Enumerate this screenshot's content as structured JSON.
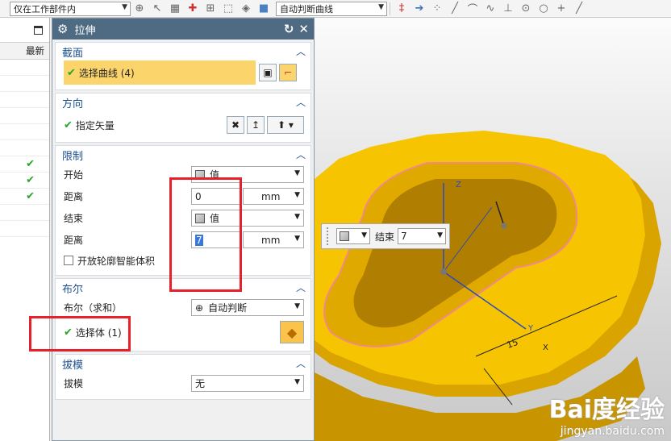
{
  "toolbar": {
    "scope_select": "仅在工作部件内",
    "curve_rule_select": "自动判断曲线"
  },
  "navigator": {
    "column_header": "最新",
    "checkmarks": [
      "✔",
      "✔",
      "✔"
    ]
  },
  "dialog": {
    "title": "拉伸",
    "section": {
      "title": "截面",
      "select_curve": "选择曲线 (4)"
    },
    "direction": {
      "title": "方向",
      "specify_vector": "指定矢量"
    },
    "limits": {
      "title": "限制",
      "start_label": "开始",
      "start_value": "值",
      "start_distance_label": "距离",
      "start_distance": "0",
      "start_unit": "mm",
      "end_label": "结束",
      "end_value": "值",
      "end_distance_label": "距离",
      "end_distance": "7",
      "end_unit": "mm",
      "open_profile_label": "开放轮廓智能体积"
    },
    "boolean": {
      "title": "布尔",
      "boolean_label": "布尔（求和）",
      "boolean_value": "自动判断",
      "select_body": "选择体 (1)"
    },
    "draft": {
      "title": "拔模",
      "draft_label": "拔模",
      "draft_value": "无"
    }
  },
  "viewport": {
    "float_label": "结束",
    "float_value": "7",
    "dim_label": "15",
    "axis_z": "Z",
    "axis_y": "Y",
    "axis_x": "X",
    "watermark_logo": "Bai度经验",
    "watermark_url": "jingyan.baidu.com"
  },
  "colors": {
    "title_bar": "#4f6b84",
    "section_text": "#1e4f8f",
    "selection_bar": "#fbd46c",
    "highlight_box": "#e8202a",
    "part_yellow": "#f6c400",
    "check_green": "#2aa52a"
  }
}
